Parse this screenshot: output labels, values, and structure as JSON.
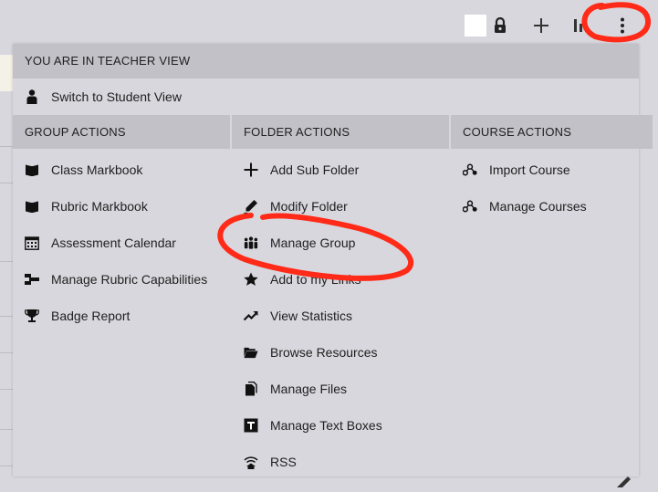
{
  "toolbar": {
    "icons": [
      "lock-icon",
      "plus-icon",
      "settings-icon",
      "kebab-menu-icon"
    ]
  },
  "menu": {
    "teacher_view_label": "YOU ARE IN TEACHER VIEW",
    "switch_student_label": "Switch to Student View",
    "group_actions": {
      "title": "GROUP ACTIONS",
      "items": [
        {
          "label": "Class Markbook",
          "icon": "book-icon"
        },
        {
          "label": "Rubric Markbook",
          "icon": "book-icon"
        },
        {
          "label": "Assessment Calendar",
          "icon": "calendar-icon"
        },
        {
          "label": "Manage Rubric Capabilities",
          "icon": "capabilities-icon"
        },
        {
          "label": "Badge Report",
          "icon": "trophy-icon"
        }
      ]
    },
    "folder_actions": {
      "title": "FOLDER ACTIONS",
      "items": [
        {
          "label": "Add Sub Folder",
          "icon": "plus-icon"
        },
        {
          "label": "Modify Folder",
          "icon": "pencil-icon"
        },
        {
          "label": "Manage Group",
          "icon": "group-icon"
        },
        {
          "label": "Add to my Links",
          "icon": "star-icon"
        },
        {
          "label": "View Statistics",
          "icon": "trend-icon"
        },
        {
          "label": "Browse Resources",
          "icon": "folder-open-icon"
        },
        {
          "label": "Manage Files",
          "icon": "files-icon"
        },
        {
          "label": "Manage Text Boxes",
          "icon": "text-box-icon"
        },
        {
          "label": "RSS",
          "icon": "rss-icon"
        }
      ]
    },
    "course_actions": {
      "title": "COURSE ACTIONS",
      "items": [
        {
          "label": "Import Course",
          "icon": "course-icon"
        },
        {
          "label": "Manage Courses",
          "icon": "course-icon"
        }
      ]
    }
  },
  "colors": {
    "background": "#d8d7de",
    "header_bg": "#c2c1c8",
    "annotation": "#ff2a17"
  }
}
